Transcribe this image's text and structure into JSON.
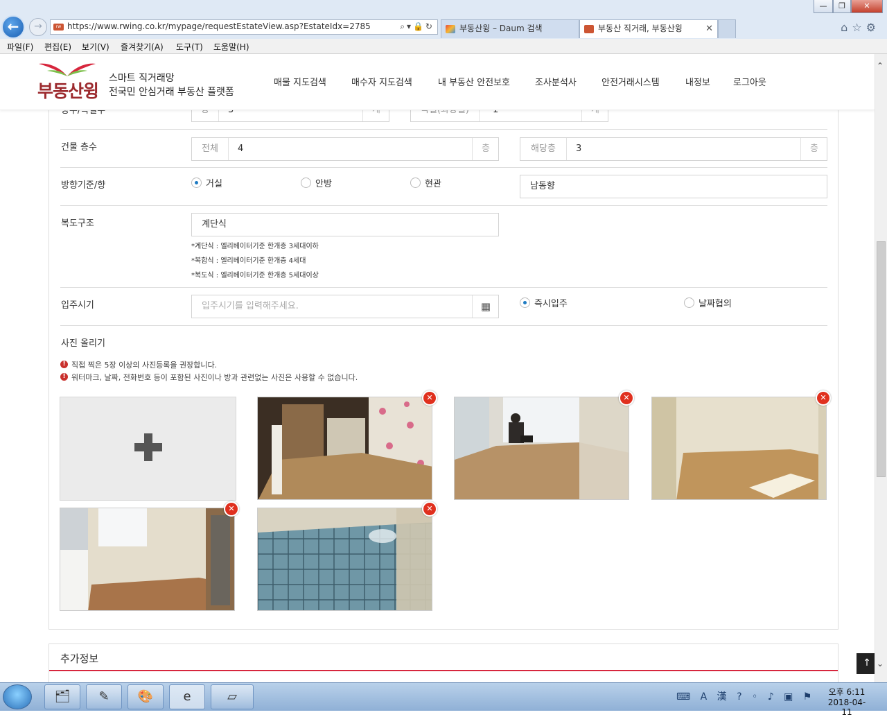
{
  "window": {
    "minimize": "—",
    "restore": "❐",
    "close": "✕"
  },
  "browser": {
    "address": "https://www.rwing.co.kr/mypage/requestEstateView.asp?EstateIdx=2785",
    "tabs": [
      {
        "label": "부동산윙 – Daum 검색"
      },
      {
        "label": "부동산 직거래, 부동산윙"
      }
    ],
    "menu": [
      "파일(F)",
      "편집(E)",
      "보기(V)",
      "즐겨찾기(A)",
      "도구(T)",
      "도움말(H)"
    ]
  },
  "site": {
    "logo": "부동산윙",
    "tagline_1": "스마트 직거래망",
    "tagline_2": "전국민 안심거래 부동산 플랫폼",
    "nav": [
      "매물 지도검색",
      "매수자 지도검색",
      "내 부동산 안전보호",
      "조사분석사",
      "안전거래시스템",
      "내정보",
      "로그아웃"
    ],
    "brand_color": "#9c2a2e",
    "accent_color": "#d7263d"
  },
  "form": {
    "rooms": {
      "label": "방수/욕실수",
      "room_prefix": "방",
      "room_value": "3",
      "room_suffix": "개",
      "bath_prefix": "욕실(화장실)",
      "bath_value": "1",
      "bath_suffix": "개"
    },
    "floors": {
      "label": "건물 층수",
      "total_prefix": "전체",
      "total_value": "4",
      "total_suffix": "층",
      "this_prefix": "해당층",
      "this_value": "3",
      "this_suffix": "층"
    },
    "direction": {
      "label": "방향기준/향",
      "options": [
        "거실",
        "안방",
        "현관"
      ],
      "selected": "거실",
      "value": "남동향"
    },
    "hallway": {
      "label": "복도구조",
      "value": "계단식",
      "notes": [
        "*계단식 : 엘리베이터기준 한개층 3세대이하",
        "*복합식 : 엘리베이터기준 한개층 4세대",
        "*복도식 : 엘리베이터기준 한개층 5세대이상"
      ]
    },
    "move_in": {
      "label": "입주시기",
      "placeholder": "입주시기를 입력해주세요.",
      "options": [
        "즉시입주",
        "날짜협의"
      ],
      "selected": "즉시입주"
    },
    "photos": {
      "label": "사진 올리기",
      "info_1": "직접 찍은 5장 이상의 사진등록을 권장합니다.",
      "info_2": "워터마크, 날짜, 전화번호 등이 포함된 사진이나 방과 관련없는 사진은 사용할 수 없습니다.",
      "add_icon": "plus-icon",
      "count": 5
    }
  },
  "extra": {
    "title": "추가정보"
  },
  "taskbar": {
    "time": "오후 6:11",
    "date": "2018-04-11",
    "tray": "⌨ A 漢 ? ◦ ♪ ▣ ⚑"
  }
}
